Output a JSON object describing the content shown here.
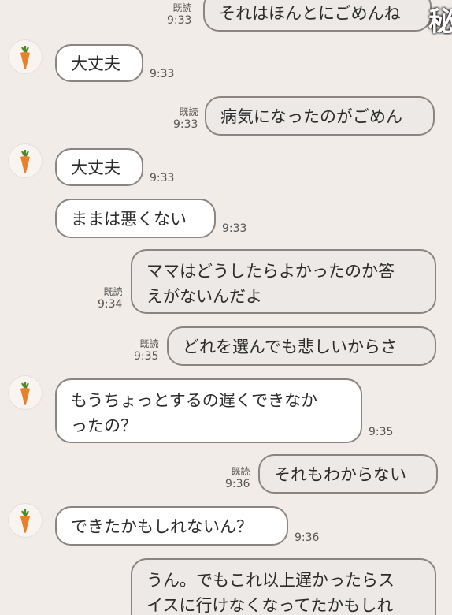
{
  "read_label": "既読",
  "watermark": "秘",
  "messages": [
    {
      "side": "out",
      "text": "それはほんとにごめんね",
      "time": "9:33",
      "read": true
    },
    {
      "side": "in",
      "text": "大丈夫",
      "time": "9:33",
      "avatar": true
    },
    {
      "side": "out",
      "text": "病気になったのがごめん",
      "time": "9:33",
      "read": true
    },
    {
      "side": "in",
      "text": "大丈夫",
      "time": "9:33",
      "avatar": true
    },
    {
      "side": "in",
      "text": "ままは悪くない",
      "time": "9:33"
    },
    {
      "side": "out",
      "line1": "ママはどうしたらよかったのか答",
      "line2": "えがないんだよ",
      "time": "9:34",
      "read": true
    },
    {
      "side": "out",
      "text": "どれを選んでも悲しいからさ",
      "time": "9:35",
      "read": true
    },
    {
      "side": "in",
      "line1": "もうちょっとするの遅くできなか",
      "line2": "ったの？",
      "time": "9:35",
      "avatar": true
    },
    {
      "side": "out",
      "text": "それもわからない",
      "time": "9:36",
      "read": true
    },
    {
      "side": "in",
      "text": "できたかもしれないん？",
      "time": "9:36",
      "avatar": true
    },
    {
      "side": "out",
      "line1": "うん。でもこれ以上遅かったらス",
      "line2": "イスに行けなくなってたかもしれ"
    }
  ]
}
